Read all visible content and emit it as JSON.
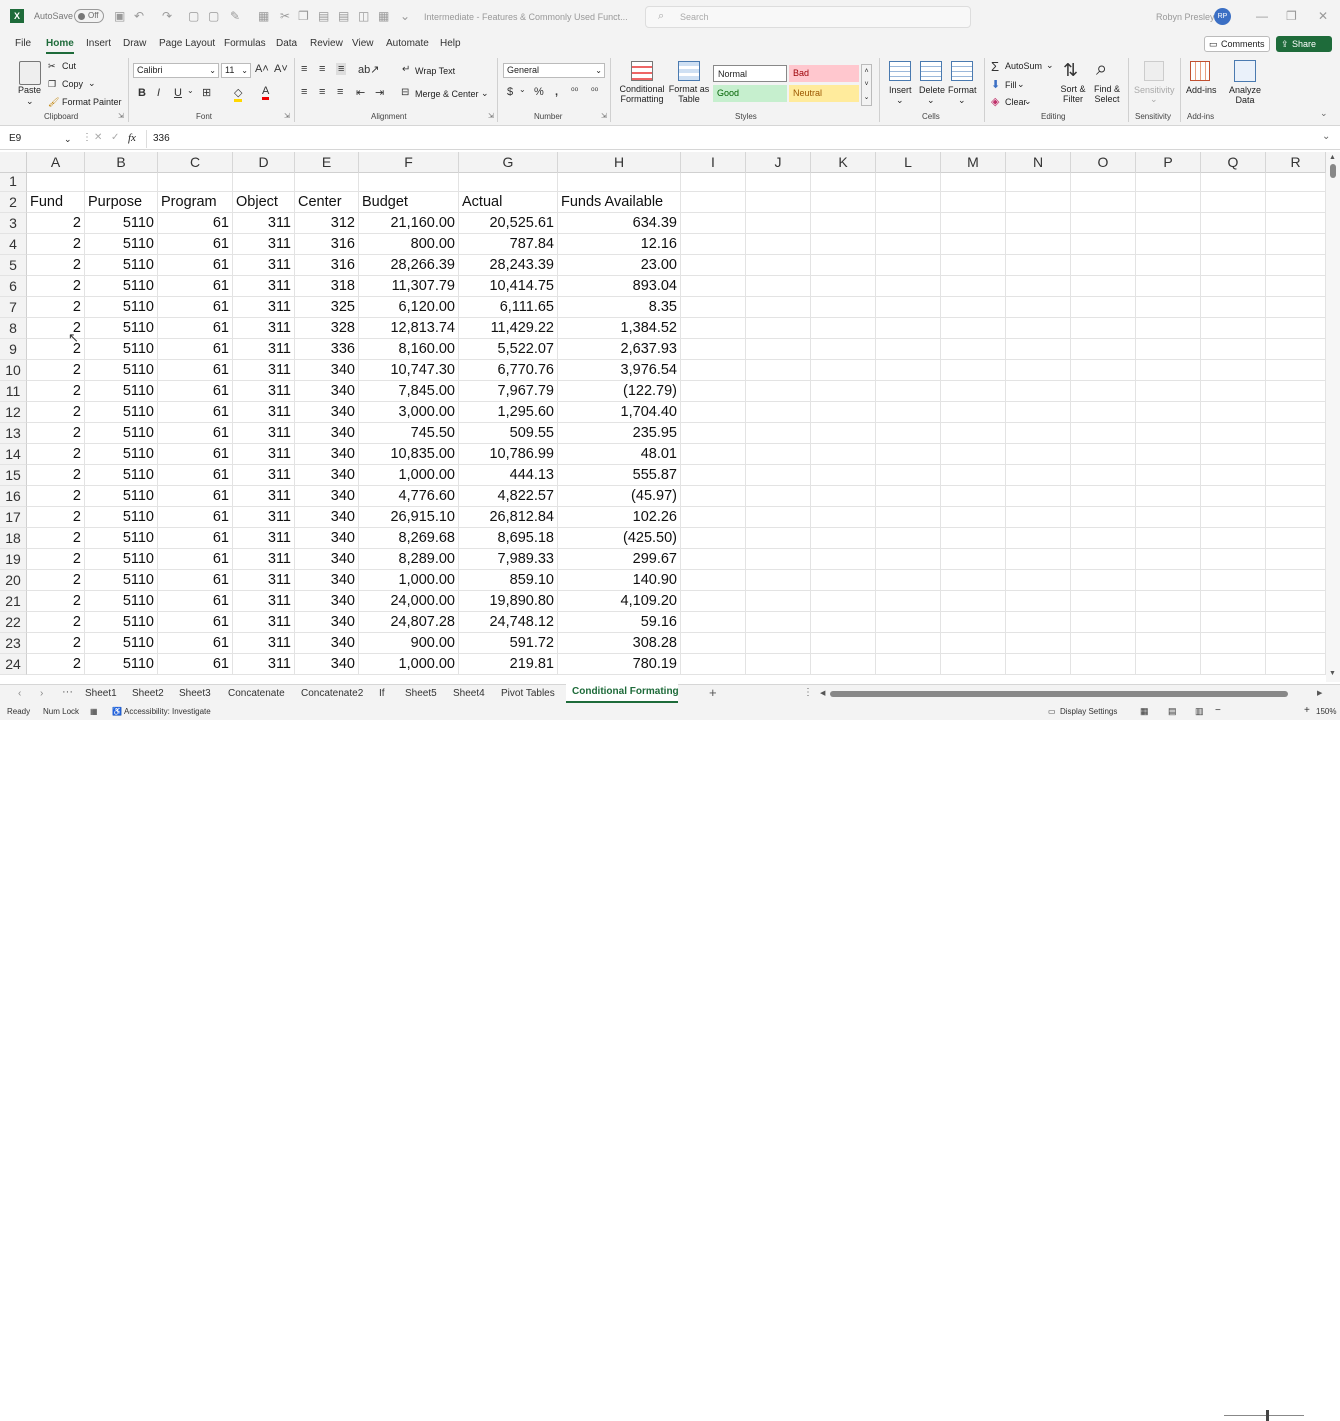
{
  "title_bar": {
    "autosave_label": "AutoSave",
    "autosave_state": "Off",
    "document_title": "Intermediate - Features & Commonly Used Funct...",
    "search_placeholder": "Search",
    "user_name": "Robyn Presley",
    "user_initials": "RP"
  },
  "menu": {
    "tabs": [
      "File",
      "Home",
      "Insert",
      "Draw",
      "Page Layout",
      "Formulas",
      "Data",
      "Review",
      "View",
      "Automate",
      "Help"
    ],
    "active_tab": "Home",
    "comments_label": "Comments",
    "share_label": "Share"
  },
  "ribbon": {
    "clipboard": {
      "paste": "Paste",
      "cut": "Cut",
      "copy": "Copy",
      "format_painter": "Format Painter",
      "group": "Clipboard"
    },
    "font": {
      "name": "Calibri",
      "size": "11",
      "group": "Font"
    },
    "alignment": {
      "wrap_text": "Wrap Text",
      "merge_center": "Merge & Center",
      "group": "Alignment"
    },
    "number": {
      "format": "General",
      "group": "Number"
    },
    "styles": {
      "conditional_formatting": "Conditional Formatting",
      "format_as_table": "Format as Table",
      "normal": "Normal",
      "bad": "Bad",
      "good": "Good",
      "neutral": "Neutral",
      "group": "Styles"
    },
    "cells": {
      "insert": "Insert",
      "delete": "Delete",
      "format": "Format",
      "group": "Cells"
    },
    "editing": {
      "autosum": "AutoSum",
      "fill": "Fill",
      "clear": "Clear",
      "sort_filter": "Sort & Filter",
      "find_select": "Find & Select",
      "group": "Editing"
    },
    "sensitivity": {
      "label": "Sensitivity",
      "group": "Sensitivity"
    },
    "addins": {
      "label": "Add-ins",
      "analyze": "Analyze Data",
      "group": "Add-ins"
    }
  },
  "formula_bar": {
    "name_box": "E9",
    "fx": "fx",
    "value": "336"
  },
  "columns": [
    "A",
    "B",
    "C",
    "D",
    "E",
    "F",
    "G",
    "H",
    "I",
    "J",
    "K",
    "L",
    "M",
    "N",
    "O",
    "P",
    "Q",
    "R"
  ],
  "rows": [
    "1",
    "2",
    "3",
    "4",
    "5",
    "6",
    "7",
    "8",
    "9",
    "10",
    "11",
    "12",
    "13",
    "14",
    "15",
    "16",
    "17",
    "18",
    "19",
    "20",
    "21",
    "22",
    "23",
    "24"
  ],
  "headers": [
    "Fund",
    "Purpose",
    "Program",
    "Object",
    "Center",
    "Budget",
    "Actual",
    "Funds Available"
  ],
  "table": [
    [
      "2",
      "5110",
      "61",
      "311",
      "312",
      "21,160.00",
      "20,525.61",
      "634.39"
    ],
    [
      "2",
      "5110",
      "61",
      "311",
      "316",
      "800.00",
      "787.84",
      "12.16"
    ],
    [
      "2",
      "5110",
      "61",
      "311",
      "316",
      "28,266.39",
      "28,243.39",
      "23.00"
    ],
    [
      "2",
      "5110",
      "61",
      "311",
      "318",
      "11,307.79",
      "10,414.75",
      "893.04"
    ],
    [
      "2",
      "5110",
      "61",
      "311",
      "325",
      "6,120.00",
      "6,111.65",
      "8.35"
    ],
    [
      "2",
      "5110",
      "61",
      "311",
      "328",
      "12,813.74",
      "11,429.22",
      "1,384.52"
    ],
    [
      "2",
      "5110",
      "61",
      "311",
      "336",
      "8,160.00",
      "5,522.07",
      "2,637.93"
    ],
    [
      "2",
      "5110",
      "61",
      "311",
      "340",
      "10,747.30",
      "6,770.76",
      "3,976.54"
    ],
    [
      "2",
      "5110",
      "61",
      "311",
      "340",
      "7,845.00",
      "7,967.79",
      "(122.79)"
    ],
    [
      "2",
      "5110",
      "61",
      "311",
      "340",
      "3,000.00",
      "1,295.60",
      "1,704.40"
    ],
    [
      "2",
      "5110",
      "61",
      "311",
      "340",
      "745.50",
      "509.55",
      "235.95"
    ],
    [
      "2",
      "5110",
      "61",
      "311",
      "340",
      "10,835.00",
      "10,786.99",
      "48.01"
    ],
    [
      "2",
      "5110",
      "61",
      "311",
      "340",
      "1,000.00",
      "444.13",
      "555.87"
    ],
    [
      "2",
      "5110",
      "61",
      "311",
      "340",
      "4,776.60",
      "4,822.57",
      "(45.97)"
    ],
    [
      "2",
      "5110",
      "61",
      "311",
      "340",
      "26,915.10",
      "26,812.84",
      "102.26"
    ],
    [
      "2",
      "5110",
      "61",
      "311",
      "340",
      "8,269.68",
      "8,695.18",
      "(425.50)"
    ],
    [
      "2",
      "5110",
      "61",
      "311",
      "340",
      "8,289.00",
      "7,989.33",
      "299.67"
    ],
    [
      "2",
      "5110",
      "61",
      "311",
      "340",
      "1,000.00",
      "859.10",
      "140.90"
    ],
    [
      "2",
      "5110",
      "61",
      "311",
      "340",
      "24,000.00",
      "19,890.80",
      "4,109.20"
    ],
    [
      "2",
      "5110",
      "61",
      "311",
      "340",
      "24,807.28",
      "24,748.12",
      "59.16"
    ],
    [
      "2",
      "5110",
      "61",
      "311",
      "340",
      "900.00",
      "591.72",
      "308.28"
    ],
    [
      "2",
      "5110",
      "61",
      "311",
      "340",
      "1,000.00",
      "219.81",
      "780.19"
    ]
  ],
  "sheets": [
    "Sheet1",
    "Sheet2",
    "Sheet3",
    "Concatenate",
    "Concatenate2",
    "If",
    "Sheet5",
    "Sheet4",
    "Pivot Tables",
    "Conditional Formating"
  ],
  "active_sheet": "Conditional Formating",
  "status": {
    "ready": "Ready",
    "num_lock": "Num Lock",
    "accessibility": "Accessibility: Investigate",
    "display_settings": "Display Settings",
    "zoom": "150%"
  },
  "colors": {
    "accent": "#1e6b3a",
    "bad_bg": "#ffc7ce",
    "bad_fg": "#9c0006",
    "good_bg": "#c6efce",
    "good_fg": "#006100",
    "neutral_bg": "#ffeb9c",
    "neutral_fg": "#9c5700"
  }
}
